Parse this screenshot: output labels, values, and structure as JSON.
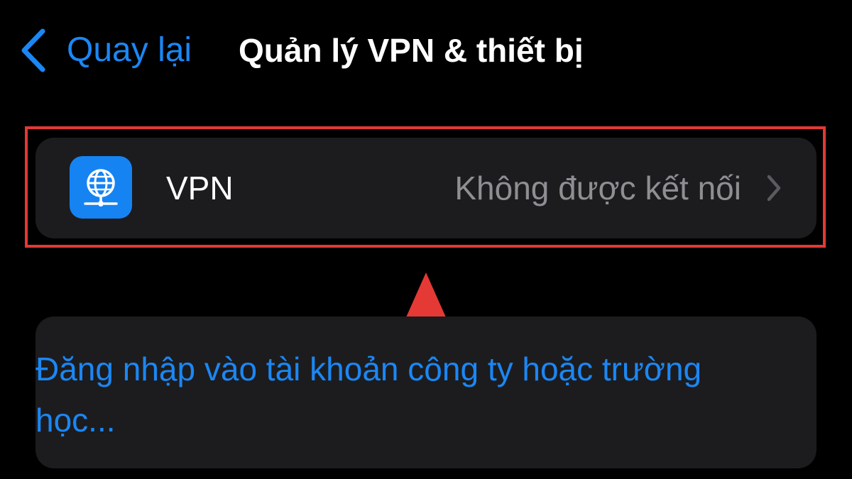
{
  "nav": {
    "back_label": "Quay lại",
    "title": "Quản lý VPN & thiết bị"
  },
  "vpn_row": {
    "icon": "vpn-globe-icon",
    "label": "VPN",
    "status": "Không được kết nối",
    "chevron": "chevron-right-icon"
  },
  "account_section": {
    "link_text": "Đăng nhập vào tài khoản công ty hoặc trường học..."
  },
  "colors": {
    "background": "#000000",
    "cell_background": "#1c1c1e",
    "accent_blue": "#1b87f4",
    "secondary_text": "#8e8e93",
    "annotation_red": "#e53935"
  }
}
